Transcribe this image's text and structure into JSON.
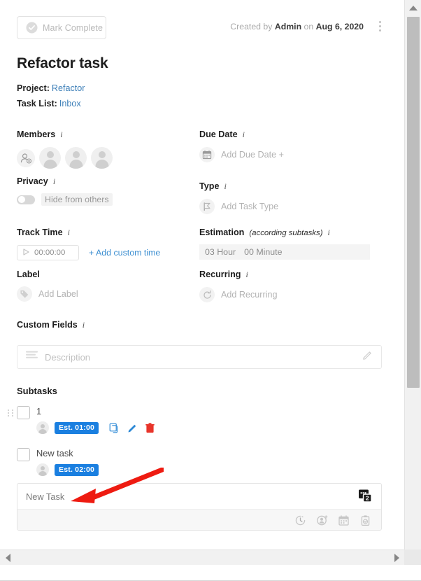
{
  "header": {
    "mark_complete_label": "Mark Complete",
    "created_prefix": "Created by",
    "created_by": "Admin",
    "created_on_word": "on",
    "created_date": "Aug 6, 2020"
  },
  "task": {
    "title": "Refactor task",
    "project_label": "Project:",
    "project_value": "Refactor",
    "tasklist_label": "Task List:",
    "tasklist_value": "Inbox"
  },
  "fields": {
    "members": {
      "label": "Members",
      "info": "i"
    },
    "due_date": {
      "label": "Due Date",
      "info": "i",
      "placeholder": "Add Due Date +"
    },
    "privacy": {
      "label": "Privacy",
      "info": "i",
      "toggle_text": "Hide from others",
      "toggle_on": false
    },
    "type": {
      "label": "Type",
      "info": "i",
      "placeholder": "Add Task Type"
    },
    "track_time": {
      "label": "Track Time",
      "info": "i",
      "timer_value": "00:00:00",
      "add_custom": "+ Add custom time"
    },
    "estimation": {
      "label": "Estimation",
      "sublabel": "(according subtasks)",
      "info": "i",
      "hours": "03 Hour",
      "minutes": "00 Minute"
    },
    "label": {
      "label": "Label",
      "placeholder": "Add Label"
    },
    "recurring": {
      "label": "Recurring",
      "info": "i",
      "placeholder": "Add Recurring"
    },
    "custom_fields": {
      "label": "Custom Fields",
      "info": "i"
    },
    "description": {
      "placeholder": "Description"
    }
  },
  "subtasks": {
    "heading": "Subtasks",
    "items": [
      {
        "name": "1",
        "estimate": "Est. 01:00",
        "has_actions": true
      },
      {
        "name": "New task",
        "estimate": "Est. 02:00",
        "has_actions": false
      }
    ]
  },
  "composer": {
    "placeholder": "New Task",
    "badge_count": "2"
  },
  "colors": {
    "accent_blue": "#1a7fe0",
    "link_blue": "#3d7fb8",
    "delete_red": "#e8342a",
    "arrow_red": "#ee1b11"
  }
}
